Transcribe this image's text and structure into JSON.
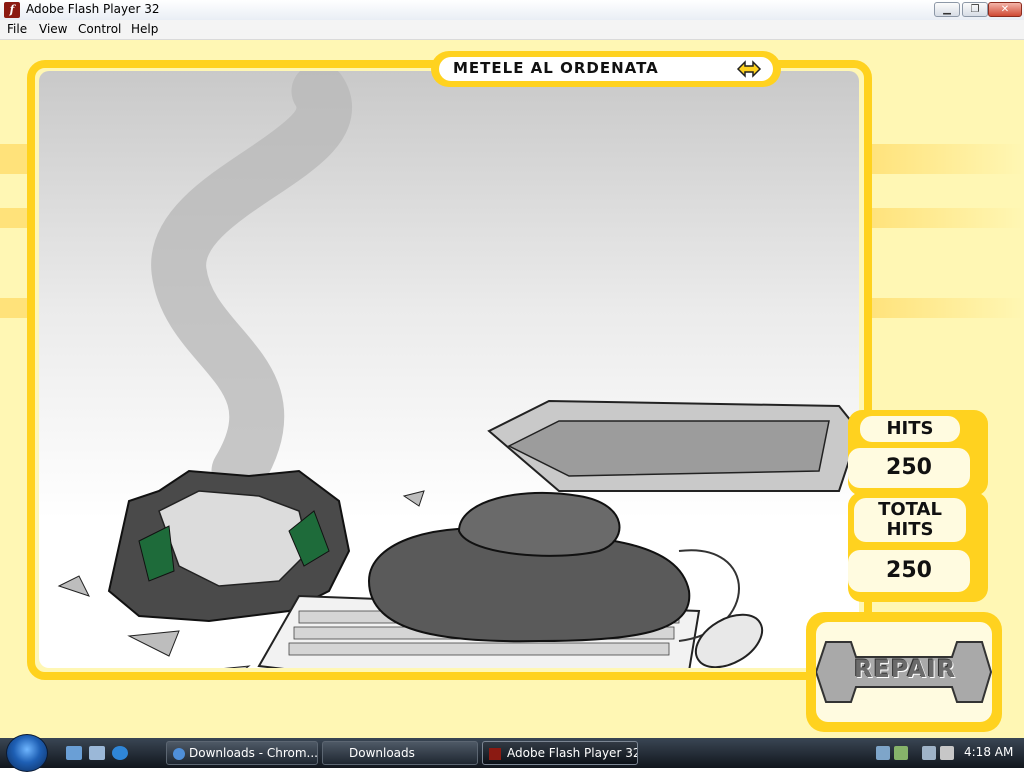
{
  "window": {
    "title": "Adobe Flash Player 32",
    "minimize_label": "▁",
    "maximize_label": "❐",
    "close_label": "✕"
  },
  "menu": {
    "items": [
      "File",
      "View",
      "Control",
      "Help"
    ]
  },
  "game": {
    "title": "METELE AL ORDENATA",
    "hits_label": "HITS",
    "hits_value": "250",
    "total_hits_label_line1": "TOTAL",
    "total_hits_label_line2": "HITS",
    "total_hits_value": "250",
    "repair_label": "REPAIR"
  },
  "taskbar": {
    "buttons": [
      {
        "label": "Downloads - Chrom..."
      },
      {
        "label": "Downloads"
      },
      {
        "label": "Adobe Flash Player 32"
      }
    ],
    "clock": "4:18 AM"
  },
  "colors": {
    "frame": "#ffd21f",
    "background": "#fff7b4"
  }
}
